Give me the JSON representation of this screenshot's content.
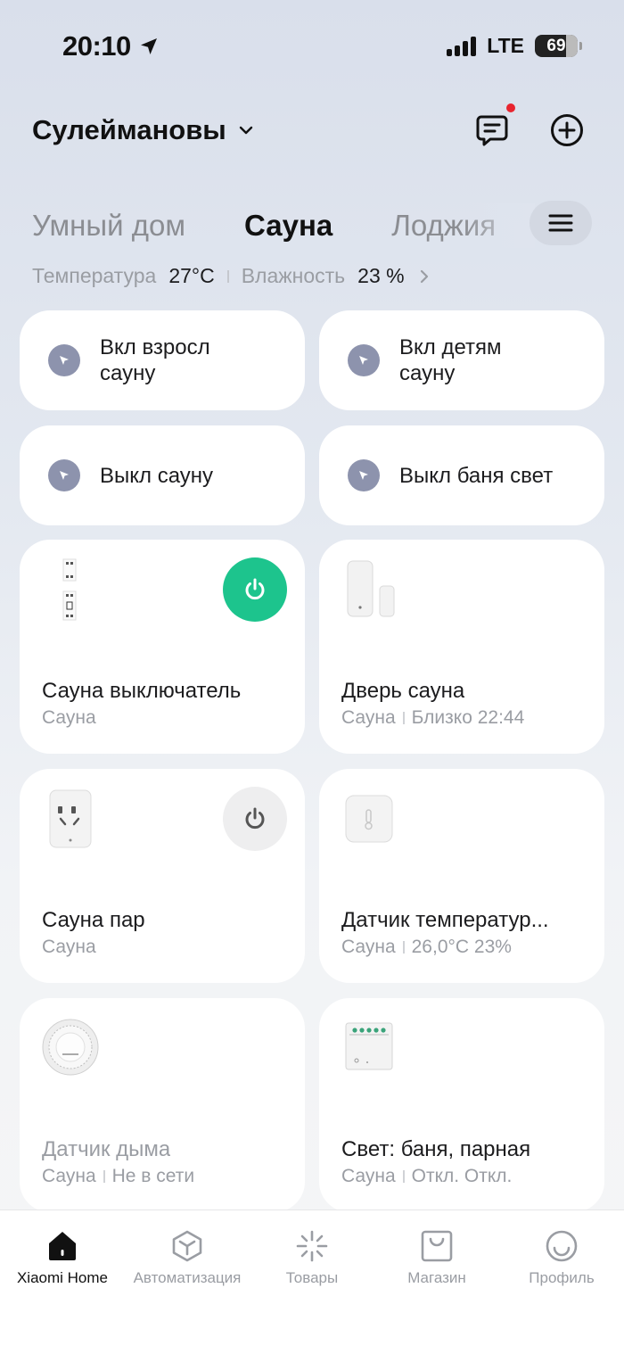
{
  "status_bar": {
    "time": "20:10",
    "network": "LTE",
    "battery": "69"
  },
  "header": {
    "home_name": "Сулеймановы"
  },
  "tabs": [
    "Умный дом",
    "Сауна",
    "Лоджия"
  ],
  "env": {
    "temp_label": "Температура",
    "temp_value": "27°C",
    "humidity_label": "Влажность",
    "humidity_value": "23 %"
  },
  "scenes": [
    {
      "line1": "Вкл взросл",
      "line2": "сауну"
    },
    {
      "line1": "Вкл детям",
      "line2": "сауну"
    },
    {
      "line1": "Выкл сауну"
    },
    {
      "line1": "Выкл баня свет"
    }
  ],
  "devices": [
    {
      "name": "Сауна выключатель",
      "room": "Сауна",
      "status": ""
    },
    {
      "name": "Дверь сауна",
      "room": "Сауна",
      "status": "Близко 22:44"
    },
    {
      "name": "Сауна пар",
      "room": "Сауна",
      "status": ""
    },
    {
      "name": "Датчик температур...",
      "room": "Сауна",
      "status": "26,0°C 23%"
    },
    {
      "name": "Датчик дыма",
      "room": "Сауна",
      "status": "Не в сети"
    },
    {
      "name": "Свет: баня, парная",
      "room": "Сауна",
      "status": "Откл. Откл."
    }
  ],
  "nav": [
    "Xiaomi Home",
    "Автоматизация",
    "Товары",
    "Магазин",
    "Профиль"
  ],
  "colors": {
    "accent_green": "#1dc48d",
    "notification_red": "#e8242f",
    "scene_icon": "#8d93ad"
  },
  "icons": [
    "location-arrow-icon",
    "chevron-down-icon",
    "message-icon",
    "plus-circle-icon",
    "menu-icon",
    "chevron-right-icon",
    "scene-cursor-icon",
    "power-icon",
    "home-icon",
    "automation-cube-icon",
    "products-sparkle-icon",
    "shop-bag-icon",
    "profile-smile-icon"
  ]
}
